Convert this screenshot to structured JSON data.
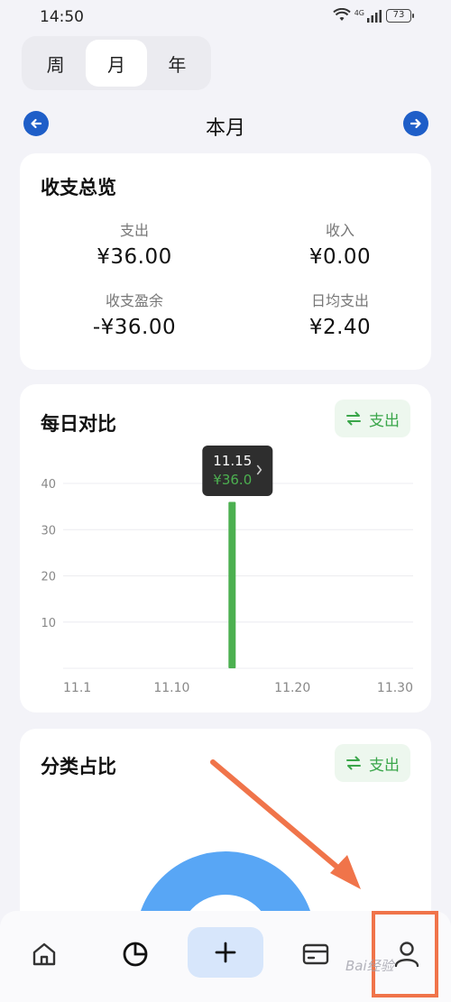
{
  "status_bar": {
    "time": "14:50",
    "network": "4G",
    "battery": "73"
  },
  "period_tabs": [
    {
      "label": "周",
      "active": false
    },
    {
      "label": "月",
      "active": true
    },
    {
      "label": "年",
      "active": false
    }
  ],
  "month_nav": {
    "title": "本月"
  },
  "overview": {
    "title": "收支总览",
    "stats": [
      {
        "label": "支出",
        "value": "¥36.00"
      },
      {
        "label": "收入",
        "value": "¥0.00"
      },
      {
        "label": "收支盈余",
        "value": "-¥36.00"
      },
      {
        "label": "日均支出",
        "value": "¥2.40"
      }
    ]
  },
  "daily_compare": {
    "title": "每日对比",
    "toggle_label": "支出",
    "tooltip": {
      "date": "11.15",
      "value": "¥36.0"
    }
  },
  "chart_data": {
    "type": "bar",
    "x_tick_labels": [
      "11.1",
      "11.10",
      "11.20",
      "11.30"
    ],
    "y_tick_labels": [
      "10",
      "20",
      "30",
      "40"
    ],
    "ylim": [
      0,
      40
    ],
    "xlim": [
      1,
      30
    ],
    "points": [
      {
        "x": 15,
        "y": 36
      }
    ],
    "grid": true,
    "bar_color": "#4cb050"
  },
  "category_ratio": {
    "title": "分类占比",
    "toggle_label": "支出",
    "donut_color": "#58a6f5"
  },
  "bottom_nav": {
    "items": [
      "home-icon",
      "pie-chart-icon",
      "plus-icon",
      "wallet-icon",
      "profile-icon"
    ]
  },
  "annotation": {
    "color": "#f0744a"
  },
  "watermark": "Bai经验"
}
